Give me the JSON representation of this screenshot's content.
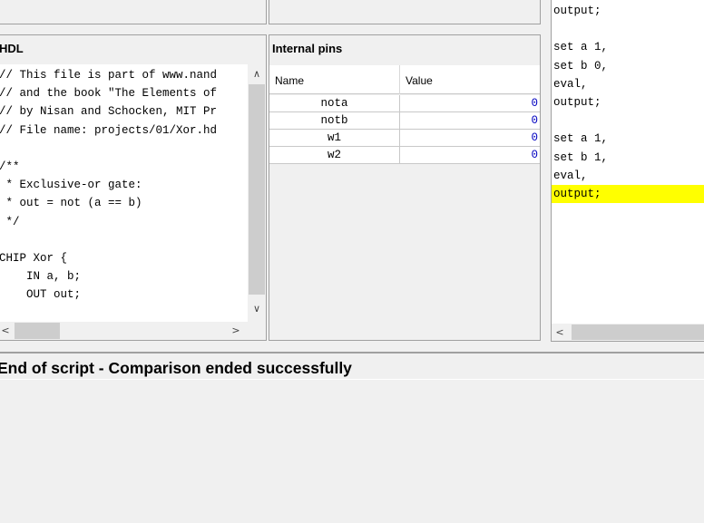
{
  "hdl": {
    "title": "HDL",
    "lines": [
      "// This file is part of www.nand",
      "// and the book \"The Elements of",
      "// by Nisan and Schocken, MIT Pr",
      "// File name: projects/01/Xor.hd",
      "",
      "/**",
      " * Exclusive-or gate:",
      " * out = not (a == b)",
      " */",
      "",
      "CHIP Xor {",
      "    IN a, b;",
      "    OUT out;"
    ]
  },
  "pins": {
    "title": "Internal pins",
    "col_name": "Name",
    "col_value": "Value",
    "rows": [
      {
        "name": "nota",
        "value": "0"
      },
      {
        "name": "notb",
        "value": "0"
      },
      {
        "name": "w1",
        "value": "0"
      },
      {
        "name": "w2",
        "value": "0"
      }
    ]
  },
  "script": {
    "lines": [
      {
        "text": "output;",
        "hl": false
      },
      {
        "text": "",
        "hl": false
      },
      {
        "text": "set a 1,",
        "hl": false
      },
      {
        "text": "set b 0,",
        "hl": false
      },
      {
        "text": "eval,",
        "hl": false
      },
      {
        "text": "output;",
        "hl": false
      },
      {
        "text": "",
        "hl": false
      },
      {
        "text": "set a 1,",
        "hl": false
      },
      {
        "text": "set b 1,",
        "hl": false
      },
      {
        "text": "eval,",
        "hl": false
      },
      {
        "text": "output;",
        "hl": true
      }
    ]
  },
  "status": {
    "message": "End of script - Comparison ended successfully"
  },
  "colors": {
    "highlight": "#ffff00",
    "value_blue": "#0000c0"
  }
}
